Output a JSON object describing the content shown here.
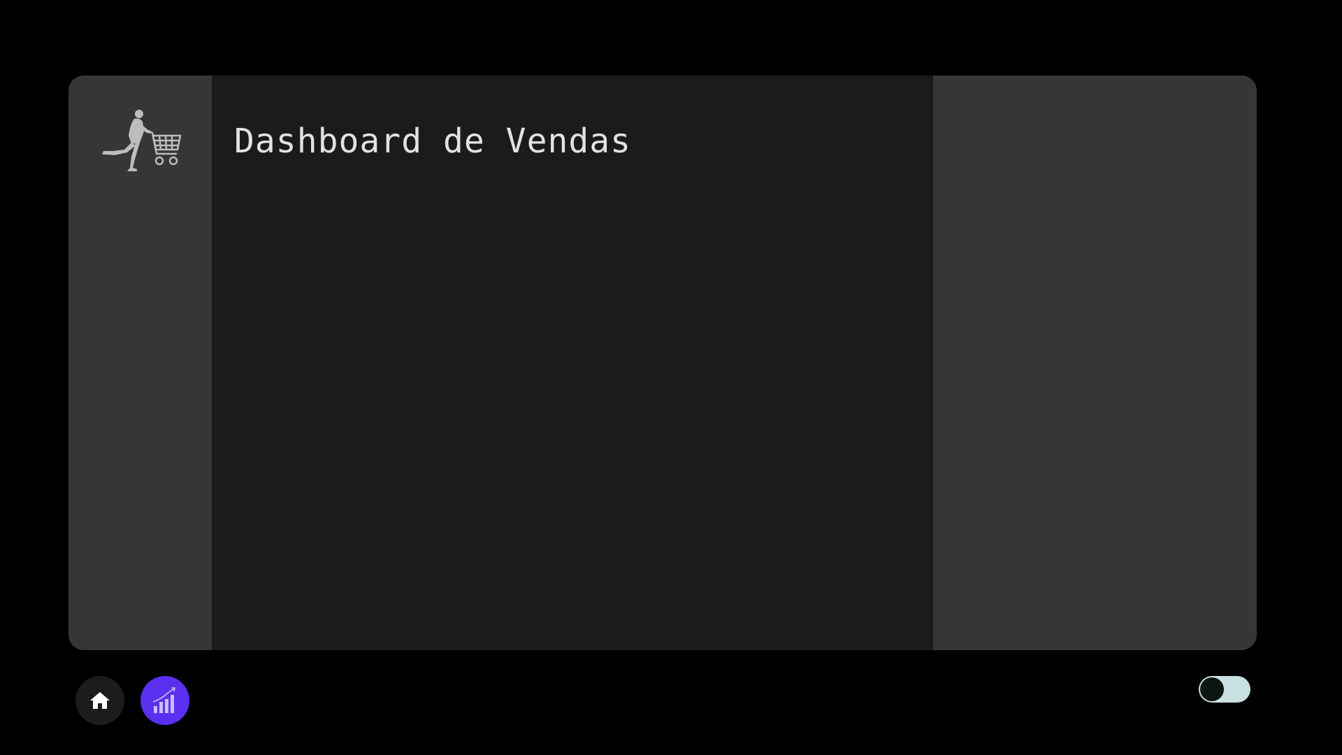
{
  "page": {
    "title": "Dashboard de Vendas"
  },
  "sidebar": {
    "logo_icon": "person-pushing-cart-icon"
  },
  "nav": {
    "items": [
      {
        "icon": "home-icon",
        "active": false
      },
      {
        "icon": "bar-chart-growth-icon",
        "active": true
      }
    ]
  },
  "theme_toggle": {
    "icon": "toggle-switch",
    "state": "off"
  },
  "colors": {
    "background": "#000000",
    "sidebar": "#363636",
    "main_panel": "#1b1b1b",
    "right_panel": "#363636",
    "title_text": "#e2e2e2",
    "accent": "#5b2ff0",
    "toggle_track": "#c9e0e0",
    "toggle_knob": "#0c1512"
  }
}
